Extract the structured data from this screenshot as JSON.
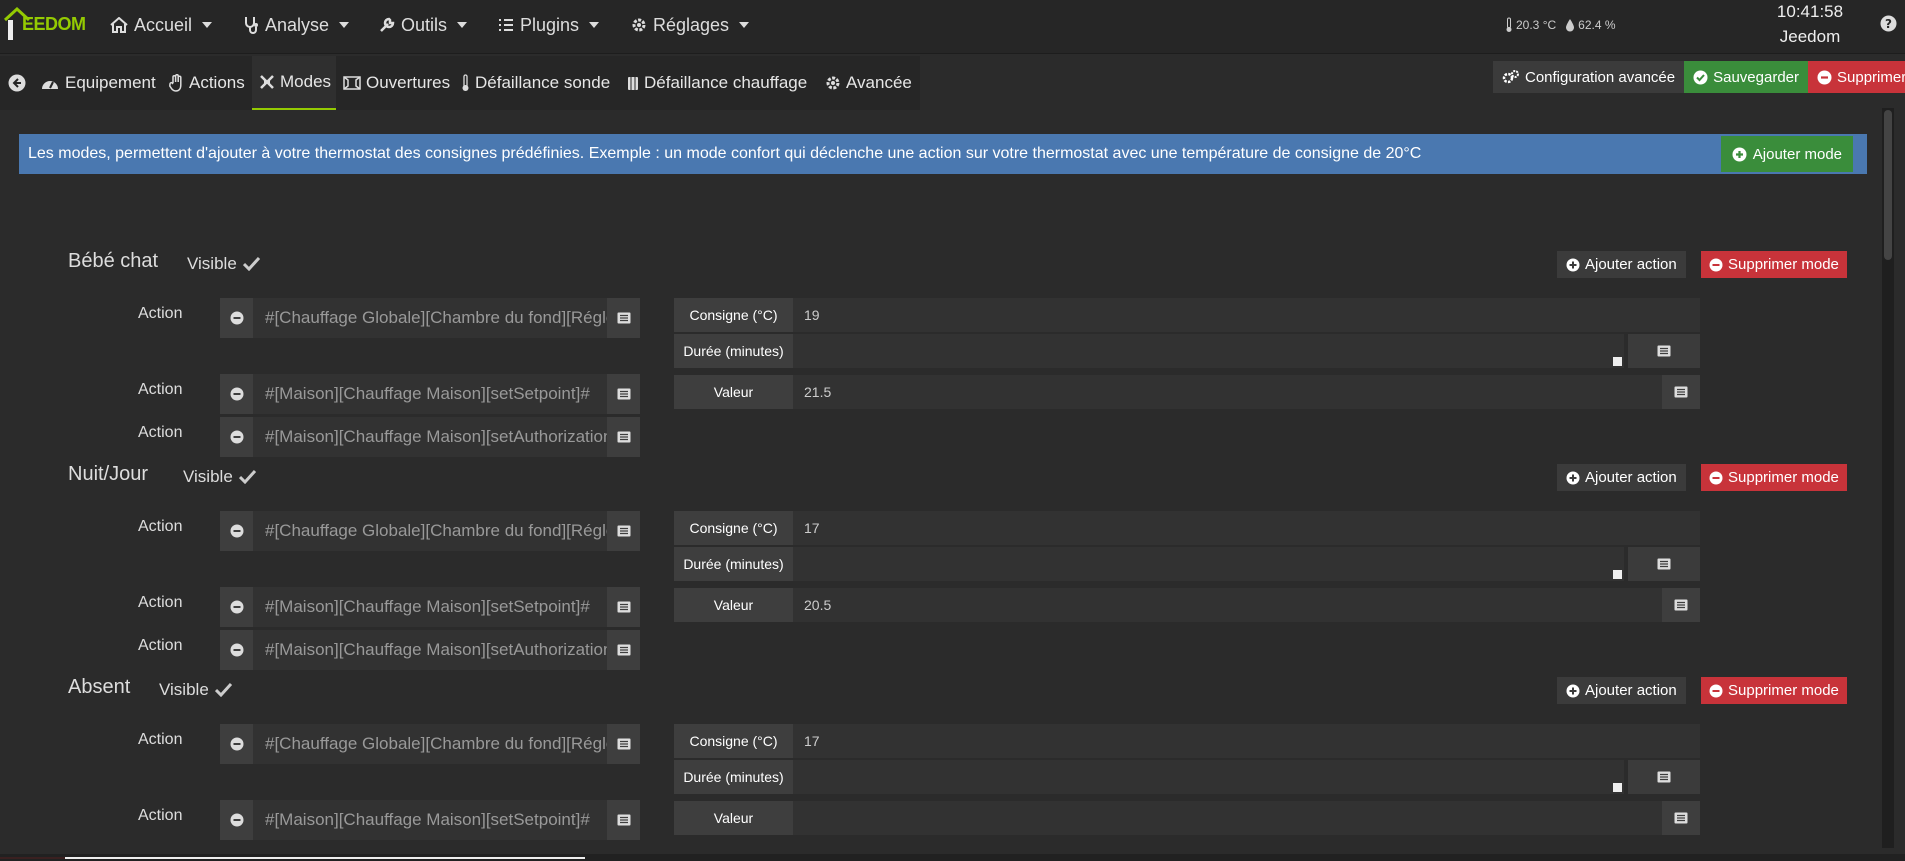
{
  "app": {
    "logo_text": "EEDOM"
  },
  "nav": [
    {
      "name": "nav-accueil",
      "label": "Accueil",
      "icon": "home-icon"
    },
    {
      "name": "nav-analyse",
      "label": "Analyse",
      "icon": "stethoscope-icon"
    },
    {
      "name": "nav-outils",
      "label": "Outils",
      "icon": "wrench-icon"
    },
    {
      "name": "nav-plugins",
      "label": "Plugins",
      "icon": "list-icon"
    },
    {
      "name": "nav-reglages",
      "label": "Réglages",
      "icon": "gear-icon"
    }
  ],
  "status": {
    "temperature": "20.3 °C",
    "humidity": "62.4 %",
    "time": "10:41:58",
    "user": "Jeedom"
  },
  "tabs": [
    {
      "label": "Equipement",
      "icon": "dashboard-icon"
    },
    {
      "label": "Actions",
      "icon": "hand-icon"
    },
    {
      "label": "Modes",
      "icon": "modes-icon",
      "active": true
    },
    {
      "label": "Ouvertures",
      "icon": "window-icon"
    },
    {
      "label": "Défaillance sonde",
      "icon": "thermometer-icon"
    },
    {
      "label": "Défaillance chauffage",
      "icon": "heater-icon"
    },
    {
      "label": "Avancée",
      "icon": "gear-icon"
    }
  ],
  "toolbar": {
    "config_label": "Configuration avancée",
    "save_label": "Sauvegarder",
    "delete_label": "Supprimer"
  },
  "info": {
    "text": "Les modes, permettent d'ajouter à votre thermostat des consignes prédéfinies. Exemple : un mode confort qui déclenche une action sur votre thermostat avec une température de consigne de 20°C",
    "add_mode_label": "Ajouter mode"
  },
  "labels": {
    "visible": "Visible",
    "add_action": "Ajouter action",
    "delete_mode": "Supprimer mode",
    "action": "Action",
    "consigne": "Consigne (°C)",
    "duree": "Durée (minutes)",
    "valeur": "Valeur"
  },
  "modes": [
    {
      "title": "Bébé chat",
      "visible": true,
      "actions": [
        {
          "cmd": "#[Chauffage Globale][Chambre du fond][Régler]#",
          "consigne": "19",
          "duree": ""
        },
        {
          "cmd": "#[Maison][Chauffage Maison][setSetpoint]#",
          "valeur": "21.5"
        },
        {
          "cmd": "#[Maison][Chauffage Maison][setAuthorization]#"
        }
      ]
    },
    {
      "title": "Nuit/Jour",
      "visible": true,
      "actions": [
        {
          "cmd": "#[Chauffage Globale][Chambre du fond][Régler]#",
          "consigne": "17",
          "duree": ""
        },
        {
          "cmd": "#[Maison][Chauffage Maison][setSetpoint]#",
          "valeur": "20.5"
        },
        {
          "cmd": "#[Maison][Chauffage Maison][setAuthorization]#"
        }
      ]
    },
    {
      "title": "Absent",
      "visible": true,
      "actions": [
        {
          "cmd": "#[Chauffage Globale][Chambre du fond][Régler]#",
          "consigne": "17",
          "duree": ""
        },
        {
          "cmd": "#[Maison][Chauffage Maison][setSetpoint]#",
          "valeur": ""
        }
      ]
    }
  ],
  "colors": {
    "accent": "#94ca02",
    "info": "#4a78b0",
    "success": "#3a8d3b",
    "danger": "#c8333a"
  }
}
